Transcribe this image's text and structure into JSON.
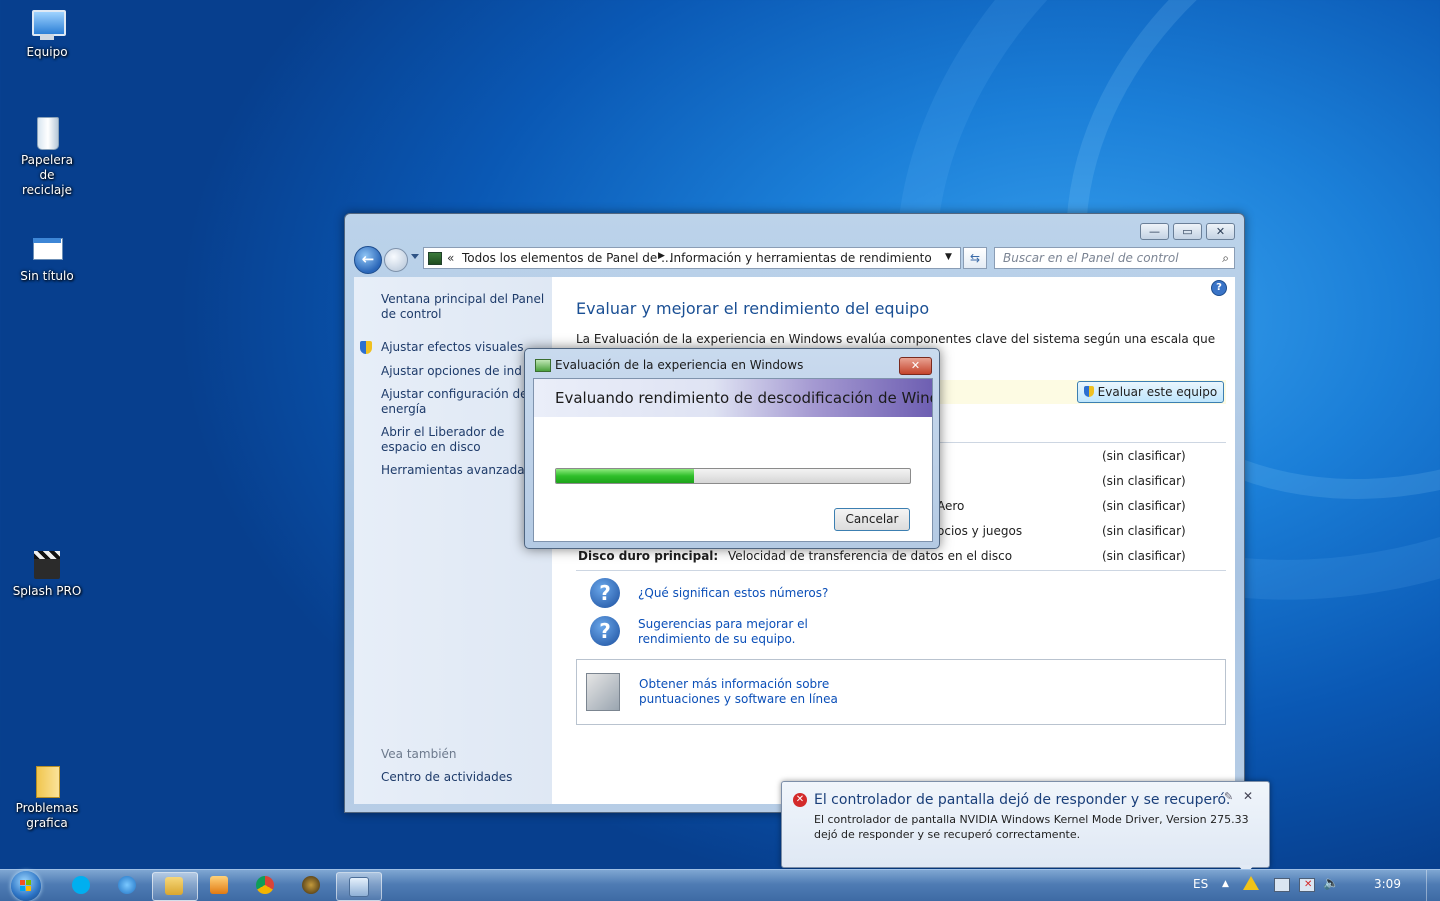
{
  "desktop": {
    "icons": [
      {
        "label": "Equipo"
      },
      {
        "label": "Papelera de reciclaje"
      },
      {
        "label": "Sin título"
      },
      {
        "label": "Splash PRO"
      },
      {
        "label": "Problemas grafica"
      }
    ]
  },
  "window": {
    "address": {
      "prefix": "«",
      "crumb1": "Todos los elementos de Panel de ...",
      "crumb2": "Información y herramientas de rendimiento"
    },
    "search_placeholder": "Buscar en el Panel de control",
    "left_pane": {
      "home_link": "Ventana principal del Panel de control",
      "links": [
        "Ajustar efectos visuales",
        "Ajustar opciones de indización",
        "Ajustar configuración de energía",
        "Abrir el Liberador de espacio en disco",
        "Herramientas avanzadas"
      ],
      "see_also_title": "Vea también",
      "see_also_links": [
        "Centro de actividades"
      ]
    },
    "content": {
      "title": "Evaluar y mejorar el rendimiento del equipo",
      "intro": "La Evaluación de la experiencia en Windows evalúa componentes clave del sistema según una escala que va",
      "rate_button": "Evaluar este equipo",
      "rows": [
        {
          "component": "",
          "desc": "",
          "score": "(sin clasificar)"
        },
        {
          "component": "",
          "desc": "",
          "score": "(sin clasificar)"
        },
        {
          "component": "",
          "desc": "Aero",
          "score": "(sin clasificar)"
        },
        {
          "component": "",
          "desc": "ocios y juegos",
          "score": "(sin clasificar)"
        },
        {
          "component": "Disco duro principal:",
          "desc": "Velocidad de transferencia de datos en el disco",
          "score": "(sin clasificar)"
        }
      ],
      "help_links": [
        {
          "text": "¿Qué significan estos números?"
        },
        {
          "text": "Sugerencias para mejorar el rendimiento de su equipo."
        }
      ],
      "online_box": {
        "text": "Obtener más información sobre puntuaciones y software en línea"
      }
    }
  },
  "dialog": {
    "title": "Evaluación de la experiencia en Windows",
    "status": "Evaluando rendimiento de descodificación de Windows",
    "progress": 0.39,
    "cancel": "Cancelar"
  },
  "notification": {
    "title": "El controlador de pantalla dejó de responder y se recuperó.",
    "body": "El controlador de pantalla NVIDIA Windows Kernel Mode Driver, Version 275.33  dejó de responder y se recuperó correctamente."
  },
  "taskbar": {
    "language": "ES",
    "clock": "3:09"
  },
  "colors": {
    "link": "#0b4fb8",
    "title": "#1a4f94",
    "progress": "#2fbf2a",
    "error": "#d32a2a"
  }
}
